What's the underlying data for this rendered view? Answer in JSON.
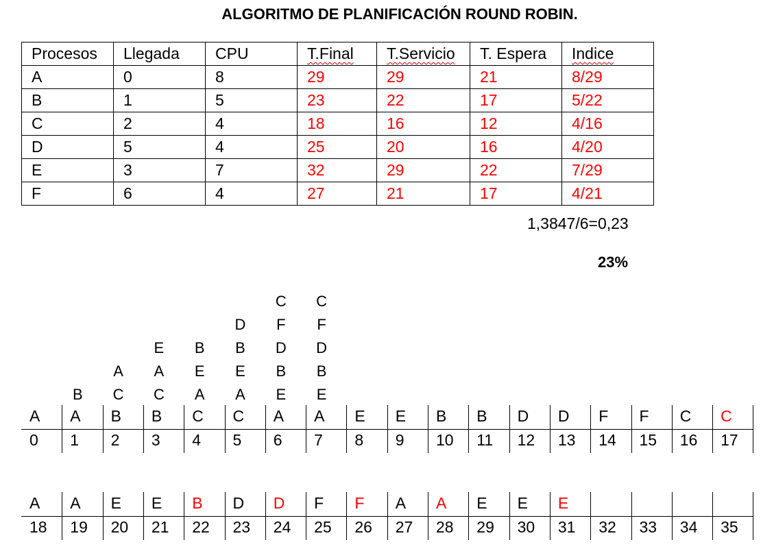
{
  "title": "ALGORITMO DE PLANIFICACIÓN ROUND ROBIN.",
  "table": {
    "headers": [
      "Procesos",
      "Llegada",
      "CPU",
      "T.Final",
      "T.Servicio",
      "T. Espera",
      "Indice"
    ],
    "rows": [
      [
        "A",
        "0",
        "8",
        "29",
        "29",
        "21",
        "8/29"
      ],
      [
        "B",
        "1",
        "5",
        "23",
        "22",
        "17",
        "5/22"
      ],
      [
        "C",
        "2",
        "4",
        "18",
        "16",
        "12",
        "4/16"
      ],
      [
        "D",
        "5",
        "4",
        "25",
        "20",
        "16",
        "4/20"
      ],
      [
        "E",
        "3",
        "7",
        "32",
        "29",
        "22",
        "7/29"
      ],
      [
        "F",
        "6",
        "4",
        "27",
        "21",
        "17",
        "4/21"
      ]
    ]
  },
  "formula": "1,3847/6=0,23",
  "percent": "23%",
  "queue_columns": [
    [],
    [
      "B"
    ],
    [
      "C",
      "A"
    ],
    [
      "C",
      "A",
      "E"
    ],
    [
      "A",
      "E",
      "B"
    ],
    [
      "A",
      "E",
      "B",
      "D"
    ],
    [
      "E",
      "B",
      "D",
      "F",
      "C"
    ],
    [
      "E",
      "B",
      "D",
      "F",
      "C"
    ]
  ],
  "timeline1": {
    "procs": [
      "A",
      "A",
      "B",
      "B",
      "C",
      "C",
      "A",
      "A",
      "E",
      "E",
      "B",
      "B",
      "D",
      "D",
      "F",
      "F",
      "C",
      "C"
    ],
    "times": [
      "0",
      "1",
      "2",
      "3",
      "4",
      "5",
      "6",
      "7",
      "8",
      "9",
      "10",
      "11",
      "12",
      "13",
      "14",
      "15",
      "16",
      "17"
    ]
  },
  "timeline2": {
    "procs": [
      "A",
      "A",
      "E",
      "E",
      "B",
      "D",
      "D",
      "F",
      "F",
      "A",
      "A",
      "E",
      "E",
      "E",
      "",
      "",
      "",
      ""
    ],
    "times": [
      "18",
      "19",
      "20",
      "21",
      "22",
      "23",
      "24",
      "25",
      "26",
      "27",
      "28",
      "29",
      "30",
      "31",
      "32",
      "33",
      "34",
      "35"
    ]
  },
  "colors": {
    "result": "#ff0000",
    "text": "#000000"
  }
}
